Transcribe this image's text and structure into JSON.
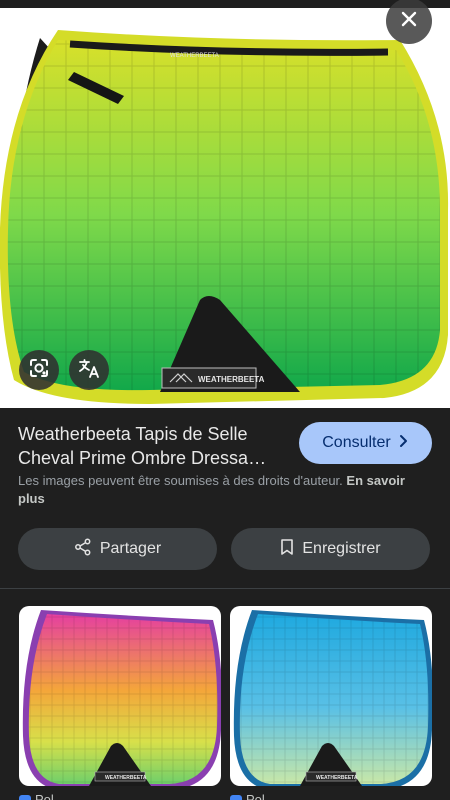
{
  "hero": {
    "brand_label": "WEATHERBEETA",
    "binding_text": "WEATHERBEETA",
    "colors": {
      "top": "#d8e02a",
      "mid": "#7fd94a",
      "bottom": "#12a84a",
      "binding": "#d4dc28",
      "underside": "#1c1c1c"
    }
  },
  "icons": {
    "close": "close-icon",
    "lens": "lens-icon",
    "translate": "translate-icon",
    "share": "share-icon",
    "bookmark": "bookmark-icon",
    "chevron": "chevron-right-icon"
  },
  "result": {
    "title": "Weatherbeeta Tapis de Selle Cheval Prime Ombre Dressa…",
    "consult_label": "Consulter",
    "copyright_text": "Les images peuvent être soumises à des droits d'auteur.",
    "learn_more": "En savoir plus",
    "share_label": "Partager",
    "save_label": "Enregistrer"
  },
  "related": [
    {
      "source": "Pol",
      "brand_label": "WEATHERBEETA",
      "colors": {
        "top": "#e53fa0",
        "mid": "#f4a63a",
        "bottom": "#6fcf6a",
        "binding": "#8a3fb0"
      }
    },
    {
      "source": "Pol",
      "brand_label": "WEATHERBEETA",
      "colors": {
        "top": "#1fa9df",
        "mid": "#59c0e6",
        "bottom": "#c8e7a8",
        "binding": "#1b6fa6"
      }
    }
  ],
  "accent": "#a8c7fa"
}
